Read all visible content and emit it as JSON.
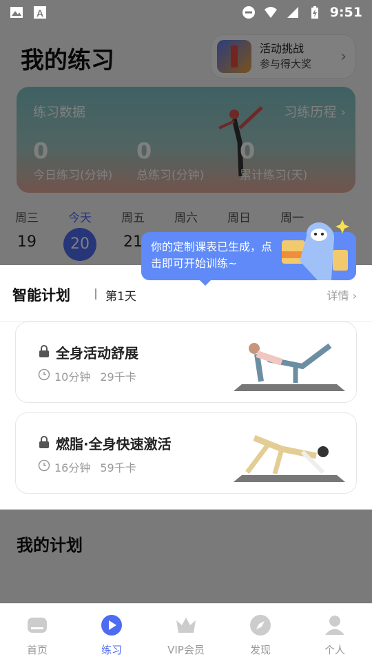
{
  "status_bar": {
    "time": "9:51",
    "left_icons": [
      "image-icon",
      "a-icon"
    ],
    "right_icons": [
      "do-not-disturb-icon",
      "wifi-icon",
      "signal-icon",
      "battery-icon"
    ]
  },
  "header": {
    "title": "我的练习",
    "challenge": {
      "title": "活动挑战",
      "subtitle": "参与得大奖"
    }
  },
  "practice_data": {
    "title": "练习数据",
    "history_link": "习练历程",
    "stats": [
      {
        "value": "0",
        "label": "今日练习(分钟)"
      },
      {
        "value": "0",
        "label": "总练习(分钟)"
      },
      {
        "value": "0",
        "label": "累计练习(天)"
      }
    ]
  },
  "week": [
    {
      "name": "周三",
      "date": "19"
    },
    {
      "name": "今天",
      "date": "20",
      "today": true
    },
    {
      "name": "周五",
      "date": "21"
    },
    {
      "name": "周六",
      "date": ""
    },
    {
      "name": "周日",
      "date": ""
    },
    {
      "name": "周一",
      "date": ""
    }
  ],
  "tooltip": {
    "text": "你的定制课表已生成，点击即可开始训练~"
  },
  "smart_plan": {
    "title": "智能计划",
    "day": "第1天",
    "detail": "详情",
    "courses": [
      {
        "name": "全身活动舒展",
        "duration": "10分钟",
        "calories": "29千卡"
      },
      {
        "name": "燃脂·全身快速激活",
        "duration": "16分钟",
        "calories": "59千卡"
      }
    ]
  },
  "my_plan": {
    "title": "我的计划"
  },
  "bottom_nav": [
    {
      "label": "首页",
      "icon": "home-icon"
    },
    {
      "label": "练习",
      "icon": "play-circle-icon",
      "active": true
    },
    {
      "label": "VIP会员",
      "icon": "crown-icon"
    },
    {
      "label": "发现",
      "icon": "compass-icon"
    },
    {
      "label": "个人",
      "icon": "person-icon"
    }
  ],
  "colors": {
    "accent": "#4e6bf2",
    "tooltip": "#5f8af7",
    "overlay": "rgba(0,0,0,0.5)"
  }
}
